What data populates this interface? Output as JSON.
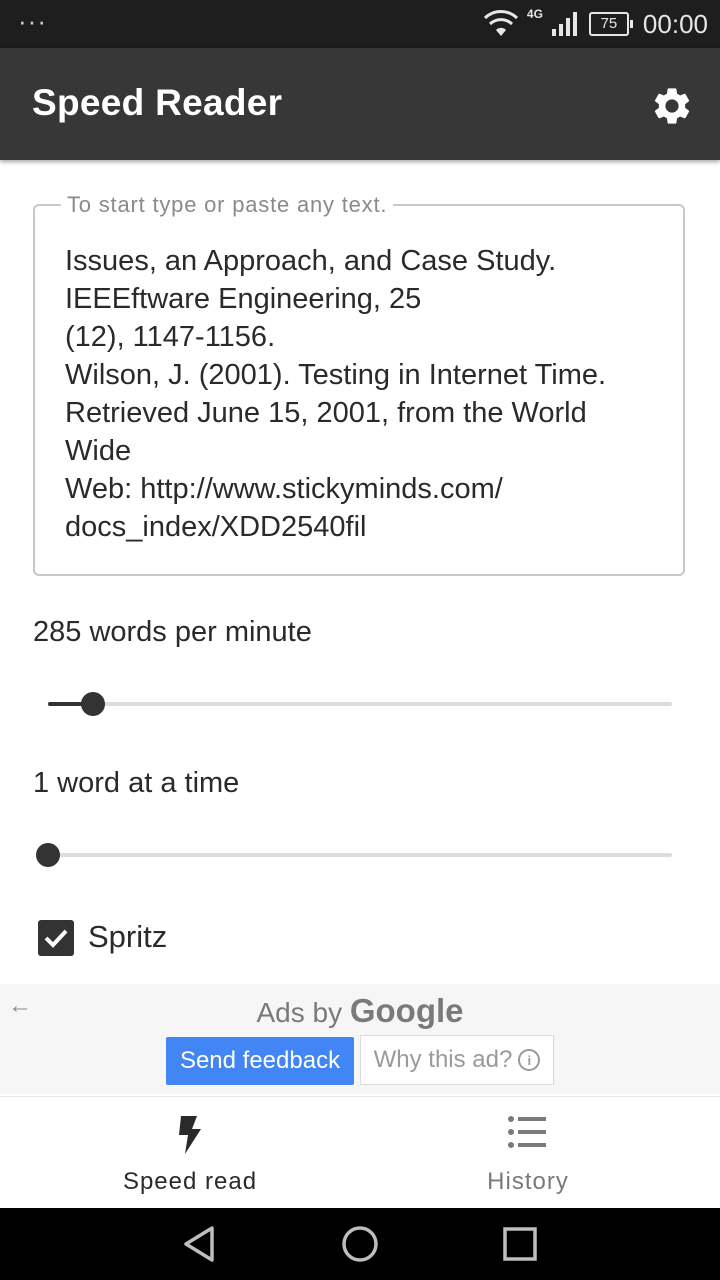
{
  "status_bar": {
    "dots": "···",
    "network": "4G",
    "battery": "75",
    "time": "00:00"
  },
  "app_bar": {
    "title": "Speed Reader",
    "settings_icon": "gear-icon"
  },
  "text_input": {
    "placeholder": "To start type or paste any text.",
    "value": "Issues, an Approach, and Case Study.\nIEEEftware Engineering, 25\n(12), 1147-1156.\nWilson, J. (2001).  Testing in Internet Time.  Retrieved June 15, 2001, from the World Wide\nWeb: http://www.stickyminds.com/\ndocs_index/XDD2540fil"
  },
  "speed": {
    "label": "285 words per minute",
    "value": 285,
    "position_fraction": 0.072
  },
  "words": {
    "label": "1 word at a time",
    "value": 1,
    "position_fraction": 0.0
  },
  "spritz": {
    "label": "Spritz",
    "checked": true
  },
  "ad": {
    "ads_by": "Ads by",
    "google": "Google",
    "send_feedback": "Send feedback",
    "why_this_ad": "Why this ad?",
    "back_icon": "arrow-left-icon",
    "info_icon": "info-icon"
  },
  "tabs": [
    {
      "label": "Speed read",
      "icon": "lightning-icon",
      "active": true
    },
    {
      "label": "History",
      "icon": "list-icon",
      "active": false
    }
  ],
  "colors": {
    "app_bar": "#373737",
    "status_bar": "#1e1e1e",
    "send_feedback": "#4285f4"
  }
}
